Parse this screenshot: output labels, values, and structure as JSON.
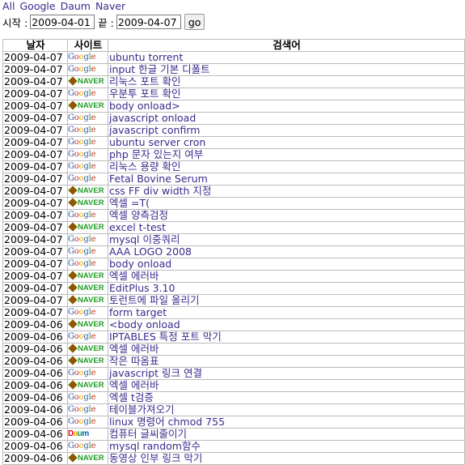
{
  "filters": [
    "All",
    "Google",
    "Daum",
    "Naver"
  ],
  "range": {
    "start_label": "시작 :",
    "start_value": "2009-04-01",
    "end_label": "끝 :",
    "end_value": "2009-04-07",
    "go_label": "go"
  },
  "table": {
    "headers": [
      "날자",
      "사이트",
      "검색어"
    ],
    "rows": [
      {
        "date": "2009-04-07",
        "site": "google",
        "keyword": "ubuntu torrent"
      },
      {
        "date": "2009-04-07",
        "site": "google",
        "keyword": "input 한글 기본 디폴트"
      },
      {
        "date": "2009-04-07",
        "site": "naver",
        "keyword": "리눅스 포트 확인"
      },
      {
        "date": "2009-04-07",
        "site": "google",
        "keyword": "우분투 포트 확인"
      },
      {
        "date": "2009-04-07",
        "site": "naver",
        "keyword": "body onload>"
      },
      {
        "date": "2009-04-07",
        "site": "google",
        "keyword": "javascript onload"
      },
      {
        "date": "2009-04-07",
        "site": "google",
        "keyword": "javascript confirm"
      },
      {
        "date": "2009-04-07",
        "site": "google",
        "keyword": "ubuntu server cron"
      },
      {
        "date": "2009-04-07",
        "site": "google",
        "keyword": "php 문자 있는지 여부"
      },
      {
        "date": "2009-04-07",
        "site": "google",
        "keyword": "리눅스 용량 확인"
      },
      {
        "date": "2009-04-07",
        "site": "google",
        "keyword": "Fetal Bovine Serum"
      },
      {
        "date": "2009-04-07",
        "site": "naver",
        "keyword": "css FF div width 지정"
      },
      {
        "date": "2009-04-07",
        "site": "naver",
        "keyword": "엑셀 =T("
      },
      {
        "date": "2009-04-07",
        "site": "google",
        "keyword": "엑셀 양측검정"
      },
      {
        "date": "2009-04-07",
        "site": "naver",
        "keyword": "excel t-test"
      },
      {
        "date": "2009-04-07",
        "site": "google",
        "keyword": "mysql 이중쿼리"
      },
      {
        "date": "2009-04-07",
        "site": "google",
        "keyword": "AAA LOGO 2008"
      },
      {
        "date": "2009-04-07",
        "site": "google",
        "keyword": "body onload"
      },
      {
        "date": "2009-04-07",
        "site": "naver",
        "keyword": "엑셀 에러바"
      },
      {
        "date": "2009-04-07",
        "site": "naver",
        "keyword": "EditPlus 3.10"
      },
      {
        "date": "2009-04-07",
        "site": "naver",
        "keyword": "토런트에 파일 올리기"
      },
      {
        "date": "2009-04-07",
        "site": "google",
        "keyword": "form target"
      },
      {
        "date": "2009-04-06",
        "site": "naver",
        "keyword": "<body onload"
      },
      {
        "date": "2009-04-06",
        "site": "google",
        "keyword": "IPTABLES 특정 포트 막기"
      },
      {
        "date": "2009-04-06",
        "site": "naver",
        "keyword": "엑셀 에러바"
      },
      {
        "date": "2009-04-06",
        "site": "naver",
        "keyword": "작은 따옴표"
      },
      {
        "date": "2009-04-06",
        "site": "google",
        "keyword": "javascript 링크 연결"
      },
      {
        "date": "2009-04-06",
        "site": "naver",
        "keyword": "엑셀 에러바"
      },
      {
        "date": "2009-04-06",
        "site": "google",
        "keyword": "엑셀 t검증"
      },
      {
        "date": "2009-04-06",
        "site": "google",
        "keyword": "테이블가져오기"
      },
      {
        "date": "2009-04-06",
        "site": "google",
        "keyword": "linux 명령어 chmod 755"
      },
      {
        "date": "2009-04-06",
        "site": "daum",
        "keyword": "컴퓨터 글씨줄이기"
      },
      {
        "date": "2009-04-06",
        "site": "google",
        "keyword": "mysql random함수"
      },
      {
        "date": "2009-04-06",
        "site": "naver",
        "keyword": "동영상 인부 링크 막기"
      }
    ]
  },
  "logos": {
    "google": "Google",
    "naver": "NAVER",
    "daum": "Daum"
  }
}
